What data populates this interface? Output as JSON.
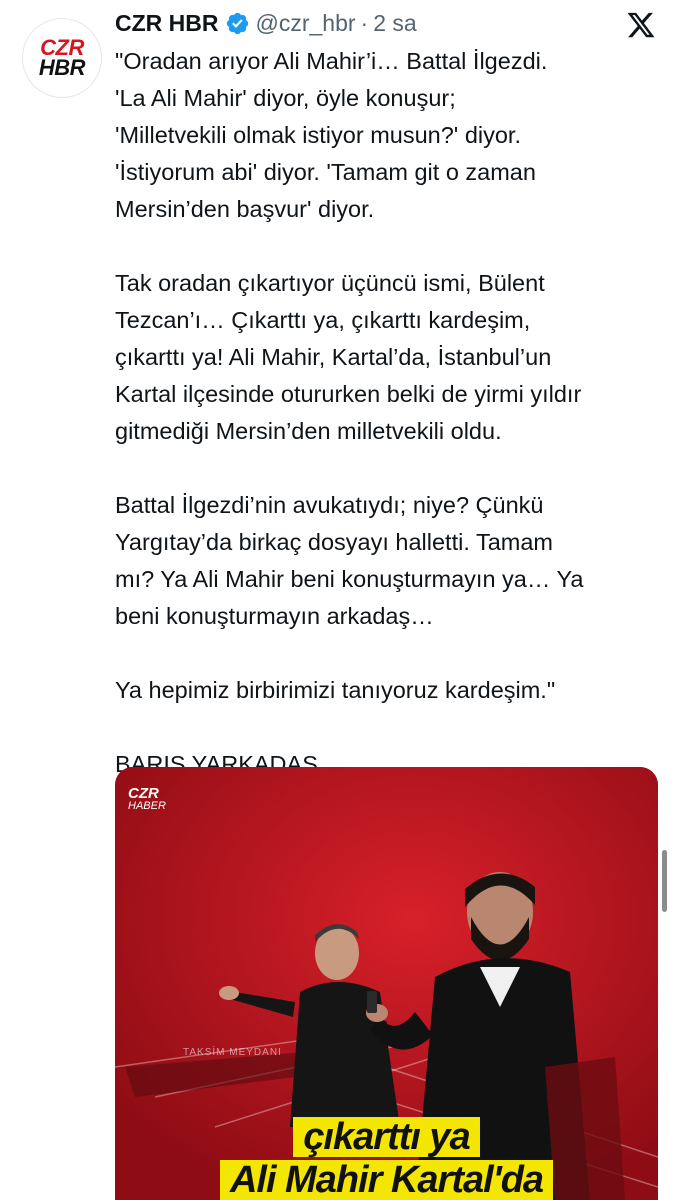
{
  "author": {
    "avatar_line1": "CZR",
    "avatar_line2": "HBR",
    "name": "CZR HBR",
    "handle": "@czr_hbr",
    "separator": "·",
    "time": "2 sa"
  },
  "tweet": {
    "paragraphs": [
      "\"Oradan arıyor Ali Mahir’i… Battal İlgezdi.\n'La Ali Mahir' diyor, öyle konuşur;\n'Milletvekili olmak istiyor musun?' diyor.\n'İstiyorum abi' diyor. 'Tamam git o zaman\nMersin’den başvur' diyor.",
      "Tak oradan çıkartıyor üçüncü ismi, Bülent\nTezcan’ı… Çıkarttı ya, çıkarttı kardeşim,\nçıkarttı ya! Ali Mahir, Kartal’da, İstanbul’un\nKartal ilçesinde otururken belki de yirmi yıldır\ngitmediği Mersin’den milletvekili oldu.",
      "Battal İlgezdi’nin avukatıydı; niye? Çünkü\nYargıtay’da birkaç dosyayı halletti. Tamam\nmı? Ya Ali Mahir beni konuşturmayın ya… Ya\nbeni konuşturmayın arkadaş…",
      "Ya hepimiz birbirimizi tanıyoruz kardeşim.\"",
      "BARIŞ YARKADAŞ"
    ]
  },
  "media": {
    "watermark_line1": "CZR",
    "watermark_line2": "HABER",
    "studio_text": "TAKSİM MEYDANI",
    "caption_line1": "çıkarttı ya",
    "caption_line2": "Ali Mahir Kartal'da"
  },
  "icons": {
    "verified": "verified-badge-icon",
    "close": "x-logo-icon"
  },
  "colors": {
    "text": "#0f1419",
    "muted": "#536471",
    "verified": "#1d9bf0",
    "caption_bg": "#f3e600",
    "studio_red": "#b3121b"
  }
}
